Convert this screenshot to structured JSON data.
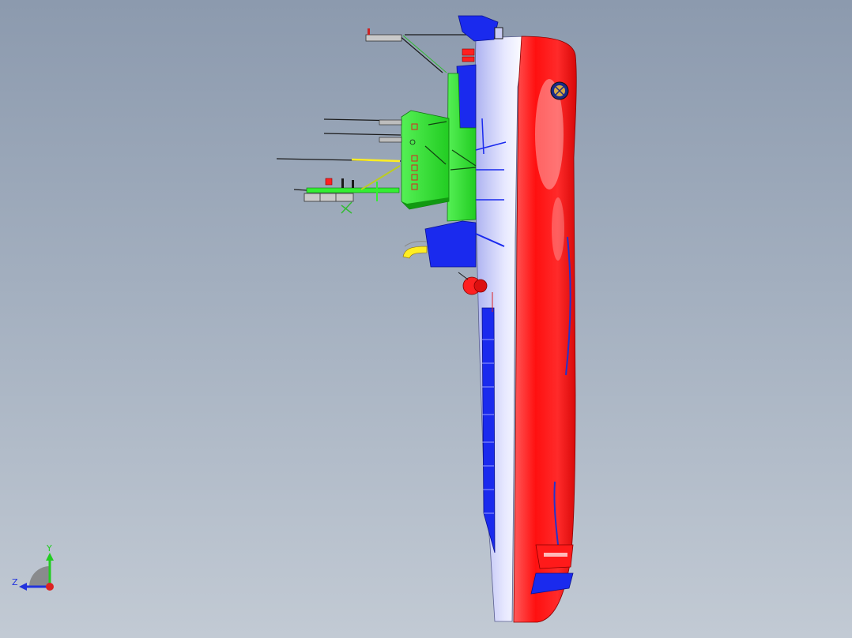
{
  "viewport": {
    "background_top": "#8c9aae",
    "background_bottom": "#c2cad4"
  },
  "model": {
    "hull_lower_color": "#ff1a1a",
    "hull_upper_color": "#c9ccf5",
    "superstructure_color": "#33ee33",
    "blue_parts_color": "#1a2aee",
    "yellow_parts_color": "#ffee22"
  },
  "triad": {
    "y_label": "Y",
    "z_label": "Z",
    "y_color": "#22cc22",
    "z_color": "#2233dd",
    "x_color": "#dd2222"
  }
}
